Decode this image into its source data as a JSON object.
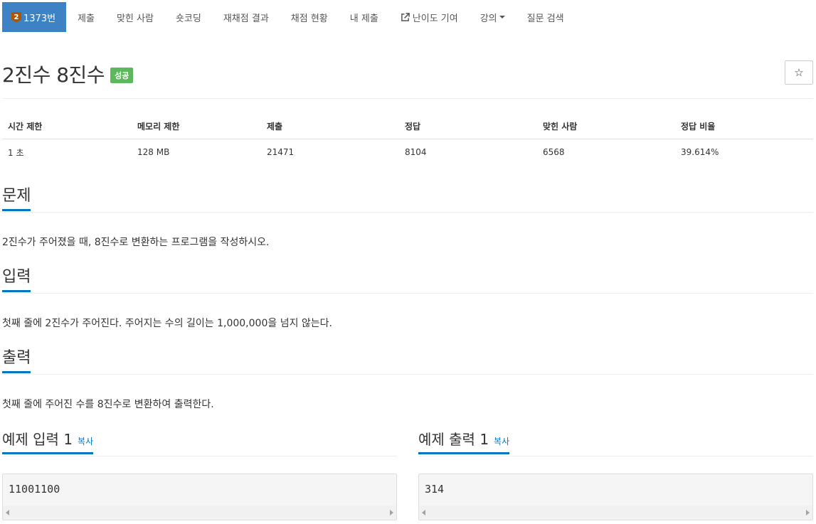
{
  "nav": {
    "problem_tab": {
      "tier": "2",
      "label": "1373번"
    },
    "items": [
      "제출",
      "맞힌 사람",
      "숏코딩",
      "재채점 결과",
      "채점 현황",
      "내 제출",
      "난이도 기여",
      "강의",
      "질문 검색"
    ]
  },
  "problem": {
    "title": "2진수 8진수",
    "status": "성공",
    "star_icon": "☆"
  },
  "info": {
    "headers": [
      "시간 제한",
      "메모리 제한",
      "제출",
      "정답",
      "맞힌 사람",
      "정답 비율"
    ],
    "values": [
      "1 초",
      "128 MB",
      "21471",
      "8104",
      "6568",
      "39.614%"
    ]
  },
  "sections": {
    "description": {
      "heading": "문제",
      "text": "2진수가 주어졌을 때, 8진수로 변환하는 프로그램을 작성하시오."
    },
    "input": {
      "heading": "입력",
      "text": "첫째 줄에 2진수가 주어진다. 주어지는 수의 길이는 1,000,000을 넘지 않는다."
    },
    "output": {
      "heading": "출력",
      "text": "첫째 줄에 주어진 수를 8진수로 변환하여 출력한다."
    }
  },
  "samples": {
    "input": {
      "heading": "예제 입력 1",
      "copy": "복사",
      "content": "11001100"
    },
    "output": {
      "heading": "예제 출력 1",
      "copy": "복사",
      "content": "314"
    }
  },
  "colors": {
    "nav_active": "#3c82c4",
    "success": "#5cb85c",
    "accent": "#0076c0",
    "tier_bronze": "#ad5600"
  }
}
